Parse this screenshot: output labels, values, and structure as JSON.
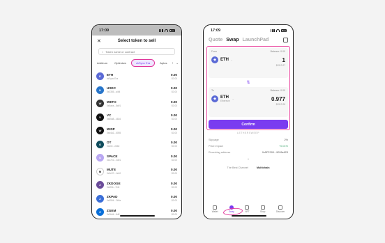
{
  "colors": {
    "accent": "#7a3cf0",
    "highlight": "#e0349a"
  },
  "status_time": "17:09",
  "select_screen": {
    "title": "Select token to sell",
    "search_placeholder": "Token name or contract",
    "chains": [
      "Arbitrum",
      "Optimism",
      "zkSync Era",
      "Aptos"
    ],
    "active_chain": "zkSync Era",
    "tokens": [
      {
        "symbol": "ETH",
        "addr": "zkSync Era",
        "amount": "0.00",
        "usd": "$0.00",
        "color": "#5b6ad6"
      },
      {
        "symbol": "USDC",
        "addr": "0x3355...a4f4",
        "amount": "0.00",
        "usd": "$0.00",
        "color": "#2775ca"
      },
      {
        "symbol": "WETH",
        "addr": "0x5aea...8a91",
        "amount": "0.00",
        "usd": "$0.00",
        "color": "#333333"
      },
      {
        "symbol": "VC",
        "addr": "0x85d8...4816",
        "amount": "0.00",
        "usd": "$0.00",
        "color": "#111111"
      },
      {
        "symbol": "WISP",
        "addr": "0xd4a1...6055",
        "amount": "0.00",
        "usd": "$0.00",
        "color": "#111111"
      },
      {
        "symbol": "OT",
        "addr": "0xd0e...e66e",
        "amount": "0.00",
        "usd": "$0.00",
        "color": "#0f4c5c"
      },
      {
        "symbol": "SPACE",
        "addr": "0x47e2...2d01",
        "amount": "0.00",
        "usd": "$0.00",
        "color": "#b9a7f2"
      },
      {
        "symbol": "MUTE",
        "addr": "0x0e97...1e40",
        "amount": "0.00",
        "usd": "$0.00",
        "color": "#ffffff"
      },
      {
        "symbol": "ZKDOGE",
        "addr": "0xbf3b...7bfe",
        "amount": "0.00",
        "usd": "$0.00",
        "color": "#6b4c9a"
      },
      {
        "symbol": "ZKPAD",
        "addr": "0x9594...2b5a",
        "amount": "0.00",
        "usd": "$0.00",
        "color": "#3b6fd8"
      },
      {
        "symbol": "ZGEM",
        "addr": "0x2b64...fb6f",
        "amount": "0.00",
        "usd": "$0.00",
        "color": "#0a6fd8"
      }
    ]
  },
  "swap_screen": {
    "tabs": [
      "Quote",
      "Swap",
      "LaunchPad"
    ],
    "active_tab": "Swap",
    "from": {
      "label": "From",
      "balance": "Balance: 0.00",
      "symbol": "ETH",
      "chain": "",
      "amount": "1",
      "usd": "$1913.27"
    },
    "to": {
      "label": "To",
      "balance": "Balance: 0.00",
      "symbol": "ETH",
      "chain": "Ethereum",
      "amount": "0.977",
      "usd": "$1913.28"
    },
    "confirm_label": "Confirm",
    "powered": "LETHERSWEEP",
    "details": [
      {
        "label": "Slippage",
        "value": "2%"
      },
      {
        "label": "Price impact",
        "value": "+0.01%"
      },
      {
        "label": "Receiving address",
        "value": "0x5FF000...9026e623"
      }
    ],
    "best_channel_label": "The Best Channel",
    "best_channel_value": "Multichain",
    "nav": [
      "Wallet",
      "Swap",
      "NFT",
      "Shop",
      "Discover"
    ],
    "active_nav": "Swap"
  }
}
